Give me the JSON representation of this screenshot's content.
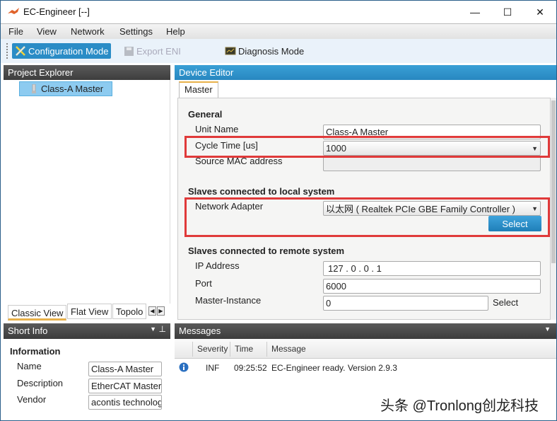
{
  "window": {
    "title": "EC-Engineer [--]",
    "controls": {
      "minimize": "—",
      "maximize": "☐",
      "close": "✕"
    }
  },
  "menu": [
    "File",
    "View",
    "Network",
    "Settings",
    "Help"
  ],
  "toolbar": {
    "configuration_mode": "Configuration Mode",
    "export_eni": "Export ENI",
    "diagnosis_mode": "Diagnosis Mode"
  },
  "project_explorer": {
    "title": "Project Explorer",
    "tree": [
      {
        "label": "Class-A Master"
      }
    ],
    "view_tabs": [
      "Classic View",
      "Flat View",
      "Topolo"
    ],
    "scroll_left": "◀",
    "scroll_right": "▶"
  },
  "short_info": {
    "title": "Short Info",
    "section": "Information",
    "fields": [
      {
        "label": "Name",
        "value": "Class-A Master"
      },
      {
        "label": "Description",
        "value": "EtherCAT Master"
      },
      {
        "label": "Vendor",
        "value": "acontis technolog"
      }
    ]
  },
  "device_editor": {
    "title": "Device Editor",
    "tab": "Master",
    "general": {
      "title": "General",
      "unit_name_label": "Unit Name",
      "unit_name_value": "Class-A Master",
      "cycle_time_label": "Cycle Time [us]",
      "cycle_time_value": "1000",
      "mac_label": "Source MAC address",
      "mac_value": ""
    },
    "local": {
      "title": "Slaves connected to local system",
      "adapter_label": "Network Adapter",
      "adapter_value": "以太网 ( Realtek PCIe GBE Family Controller )",
      "select_button": "Select"
    },
    "remote": {
      "title": "Slaves connected to remote system",
      "ip_label": "IP Address",
      "ip_value": "127 .  0  .  0  .  1",
      "port_label": "Port",
      "port_value": "6000",
      "instance_label": "Master-Instance",
      "instance_value": "0",
      "select_link": "Select"
    }
  },
  "messages": {
    "title": "Messages",
    "columns": [
      "Severity",
      "Time",
      "Message"
    ],
    "rows": [
      {
        "severity": "INF",
        "time": "09:25:52",
        "message": "EC-Engineer ready. Version 2.9.3"
      }
    ]
  },
  "watermark": "头条 @Tronlong创龙科技",
  "colors": {
    "accent_blue": "#2a8cc6",
    "highlight_red": "#e03a3a",
    "tab_underline": "#e8b14a"
  }
}
